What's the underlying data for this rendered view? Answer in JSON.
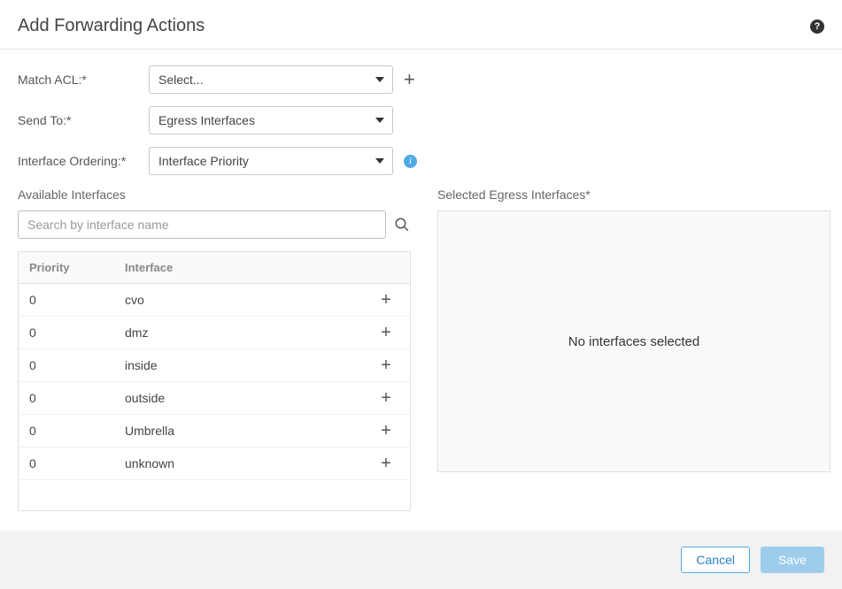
{
  "header": {
    "title": "Add Forwarding Actions"
  },
  "form": {
    "matchAcl": {
      "label": "Match ACL:*",
      "value": "Select..."
    },
    "sendTo": {
      "label": "Send To:*",
      "value": "Egress Interfaces"
    },
    "ordering": {
      "label": "Interface Ordering:*",
      "value": "Interface Priority"
    }
  },
  "available": {
    "title": "Available Interfaces",
    "searchPlaceholder": "Search by interface name",
    "columns": {
      "priority": "Priority",
      "interface": "Interface"
    },
    "rows": [
      {
        "priority": "0",
        "interface": "cvo"
      },
      {
        "priority": "0",
        "interface": "dmz"
      },
      {
        "priority": "0",
        "interface": "inside"
      },
      {
        "priority": "0",
        "interface": "outside"
      },
      {
        "priority": "0",
        "interface": "Umbrella"
      },
      {
        "priority": "0",
        "interface": "unknown"
      }
    ]
  },
  "selected": {
    "title": "Selected Egress Interfaces*",
    "empty": "No interfaces selected"
  },
  "footer": {
    "cancel": "Cancel",
    "save": "Save"
  }
}
